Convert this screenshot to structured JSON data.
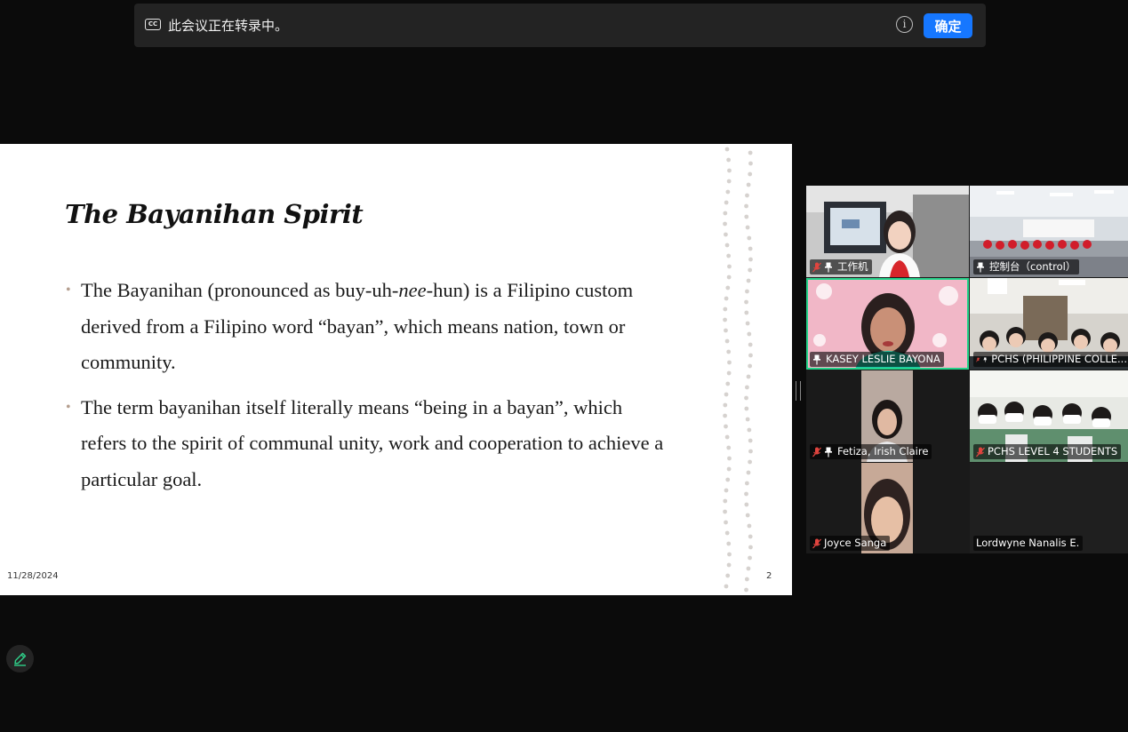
{
  "banner": {
    "icon": "closed-caption-icon",
    "text": "此会议正在转录中。",
    "cc_label": "CC",
    "info_icon": "info-icon",
    "confirm_label": "确定"
  },
  "slide": {
    "title": "The Bayanihan Spirit",
    "bullets": [
      {
        "before": "The Bayanihan (pronounced as buy-uh-",
        "em": "nee",
        "after": "-hun) is a Filipino custom derived from a Filipino word “bayan”, which means nation, town or community."
      },
      {
        "before": "The term bayanihan itself literally means “being in a bayan”, which refers to the spirit of communal unity, work and cooperation to achieve a particular goal.",
        "em": "",
        "after": ""
      }
    ],
    "date": "11/28/2024",
    "page_number": "2"
  },
  "participants": [
    {
      "name": "工作机",
      "muted": true,
      "pinned": true,
      "active": false
    },
    {
      "name": "控制台（control）",
      "muted": false,
      "pinned": true,
      "active": false
    },
    {
      "name": "KASEY LESLIE BAYONA",
      "muted": false,
      "pinned": true,
      "active": true
    },
    {
      "name": "PCHS (PHILIPPINE COLLE...",
      "muted": true,
      "pinned": true,
      "active": false
    },
    {
      "name": "Fetiza, Irish Claire",
      "muted": true,
      "pinned": true,
      "active": false
    },
    {
      "name": "PCHS LEVEL 4 STUDENTS",
      "muted": true,
      "pinned": false,
      "active": false
    },
    {
      "name": "Joyce Sanga",
      "muted": true,
      "pinned": false,
      "active": false
    },
    {
      "name": "Lordwyne Nanalis E.",
      "muted": false,
      "pinned": false,
      "active": false
    }
  ],
  "colors": {
    "accent": "#1677ff",
    "active_speaker": "#23d38a",
    "muted": "#e0443e"
  },
  "toolbar": {
    "pencil_icon": "pencil-icon"
  }
}
